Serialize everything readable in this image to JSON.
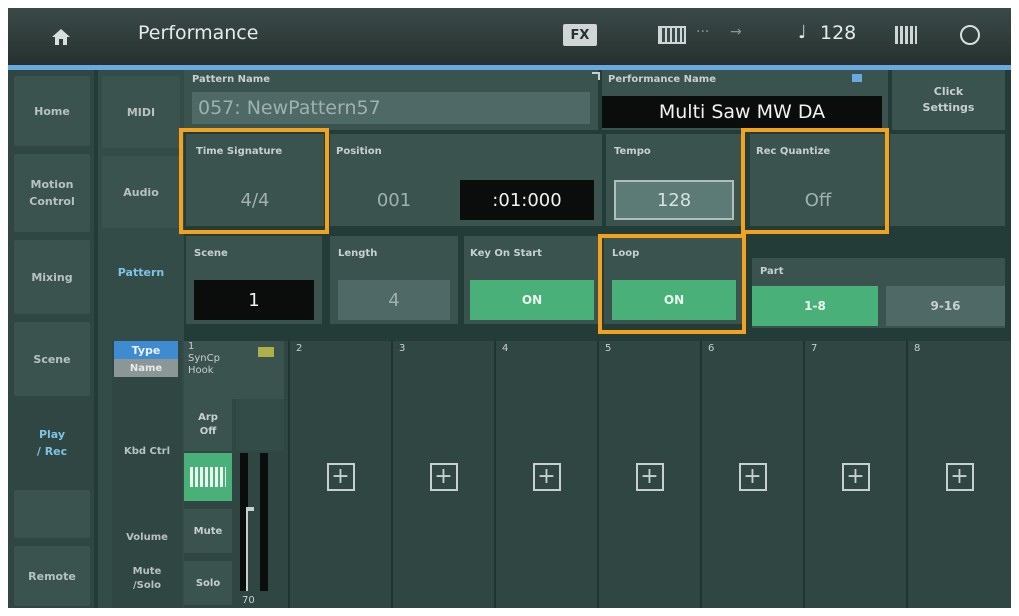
{
  "header": {
    "title": "Performance",
    "fx_badge": "FX",
    "midi_label": "···",
    "usb_label": "→",
    "note_symbol": "♩",
    "tempo": "128"
  },
  "left_nav": [
    "Home",
    "Motion\nControl",
    "Mixing",
    "Scene",
    "Play\n/ Rec",
    "Remote"
  ],
  "sub_nav": [
    "MIDI",
    "Audio",
    "Pattern"
  ],
  "pattern_name": {
    "label": "Pattern Name",
    "value": "057: NewPattern57"
  },
  "performance_name": {
    "label": "Performance Name",
    "value": "Multi Saw MW DA"
  },
  "click_settings": "Click\nSettings",
  "time_signature": {
    "label": "Time Signature",
    "value": "4/4"
  },
  "position": {
    "label": "Position",
    "measure": "001",
    "beat": ":01:000"
  },
  "tempo": {
    "label": "Tempo",
    "value": "128"
  },
  "rec_quantize": {
    "label": "Rec Quantize",
    "value": "Off"
  },
  "scene": {
    "label": "Scene",
    "value": "1"
  },
  "length": {
    "label": "Length",
    "value": "4"
  },
  "key_on_start": {
    "label": "Key On Start",
    "value": "ON"
  },
  "loop": {
    "label": "Loop",
    "value": "ON"
  },
  "part": {
    "label": "Part",
    "range1": "1-8",
    "range2": "9-16"
  },
  "track1": {
    "type": "Type",
    "name": "Name",
    "num": "1",
    "instrument": "SynCp\nHook",
    "arp": "Arp\nOff",
    "mute": "Mute",
    "solo": "Solo",
    "volume": "70"
  },
  "row_labels": {
    "kbd_ctrl": "Kbd Ctrl",
    "volume": "Volume",
    "mute_solo": "Mute\n/Solo"
  },
  "tracks": [
    "2",
    "3",
    "4",
    "5",
    "6",
    "7",
    "8"
  ],
  "plus": "+"
}
